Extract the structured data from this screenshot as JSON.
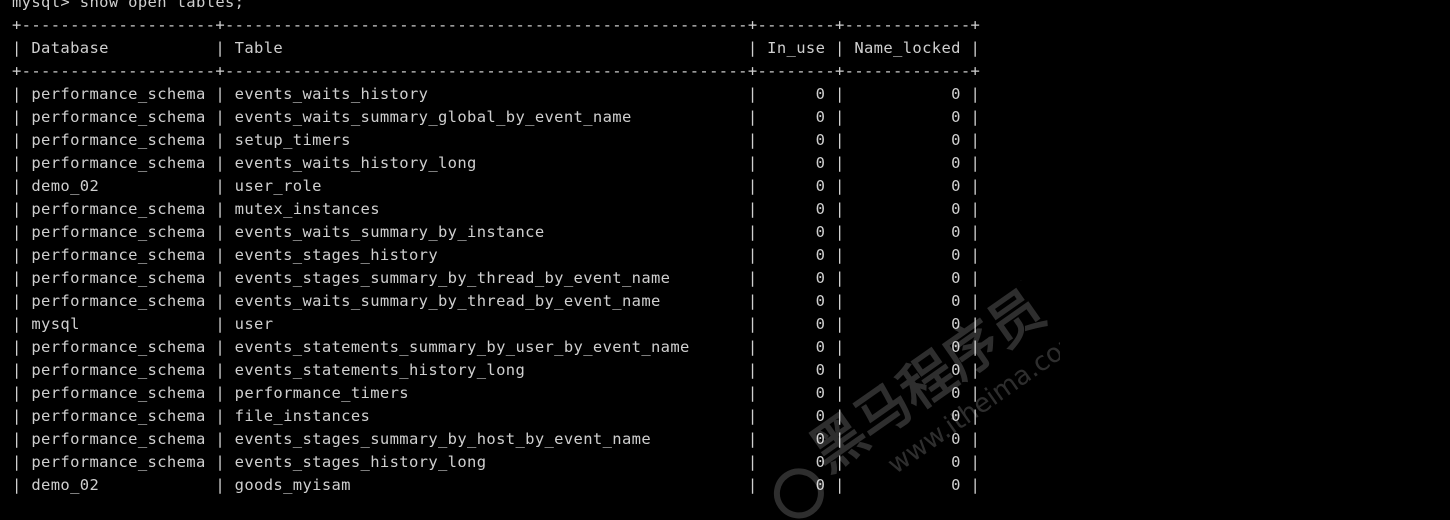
{
  "terminal": {
    "background": "#000000",
    "foreground": "#cfcfcf",
    "lines": [
      "mysql> show open tables;",
      "+--------------------+------------------------------------------------------+--------+-------------+",
      "| Database           | Table                                                | In_use | Name_locked |",
      "+--------------------+------------------------------------------------------+--------+-------------+",
      "| performance_schema | events_waits_history                                 |      0 |           0 |",
      "| performance_schema | events_waits_summary_global_by_event_name            |      0 |           0 |",
      "| performance_schema | setup_timers                                         |      0 |           0 |",
      "| performance_schema | events_waits_history_long                            |      0 |           0 |",
      "| demo_02            | user_role                                            |      0 |           0 |",
      "| performance_schema | mutex_instances                                      |      0 |           0 |",
      "| performance_schema | events_waits_summary_by_instance                     |      0 |           0 |",
      "| performance_schema | events_stages_history                                |      0 |           0 |",
      "| performance_schema | events_stages_summary_by_thread_by_event_name        |      0 |           0 |",
      "| performance_schema | events_waits_summary_by_thread_by_event_name         |      0 |           0 |",
      "| mysql              | user                                                 |      0 |           0 |",
      "| performance_schema | events_statements_summary_by_user_by_event_name      |      0 |           0 |",
      "| performance_schema | events_statements_history_long                       |      0 |           0 |",
      "| performance_schema | performance_timers                                   |      0 |           0 |",
      "| performance_schema | file_instances                                       |      0 |           0 |",
      "| performance_schema | events_stages_summary_by_host_by_event_name          |      0 |           0 |",
      "| performance_schema | events_stages_history_long                           |      0 |           0 |",
      "| demo_02            | goods_myisam                                         |      0 |           0 |"
    ]
  },
  "watermark": {
    "text_cn": "黑马程序员",
    "text_url": "www.itheima.com",
    "text_tm": "™",
    "color": "#ffffff"
  }
}
